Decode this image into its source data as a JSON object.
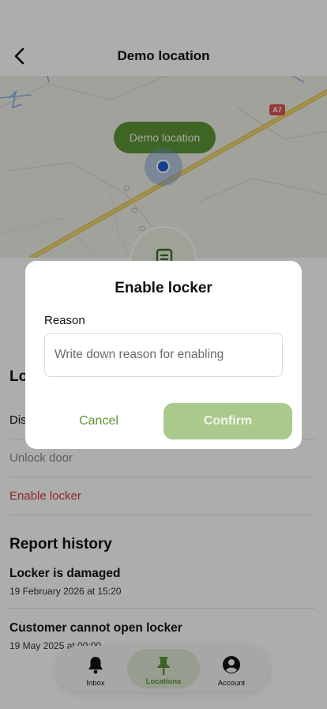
{
  "header": {
    "title": "Demo location"
  },
  "map": {
    "pin_label": "Demo location",
    "road_badge": "A7"
  },
  "locker_section": {
    "title_partial": "Lo",
    "actions": [
      "Dis",
      "Unlock door",
      "Enable locker"
    ]
  },
  "report_history": {
    "title": "Report history",
    "items": [
      {
        "title": "Locker is damaged",
        "date": "19 February 2026 at 15:20"
      },
      {
        "title": "Customer cannot open locker",
        "date": "19 May 2025 at 00:00"
      }
    ]
  },
  "tabbar": {
    "tabs": [
      {
        "label": "Inbox",
        "icon": "bell-icon"
      },
      {
        "label": "Locations",
        "icon": "pin-icon"
      },
      {
        "label": "Account",
        "icon": "account-icon"
      }
    ]
  },
  "modal": {
    "title": "Enable locker",
    "field_label": "Reason",
    "placeholder": "Write down reason for enabling",
    "value": "",
    "cancel_label": "Cancel",
    "confirm_label": "Confirm"
  },
  "colors": {
    "brand_green": "#5e9635",
    "confirm_disabled": "#a9c98d",
    "danger": "#d23b3b",
    "pin_blue": "#1e5fd0"
  }
}
